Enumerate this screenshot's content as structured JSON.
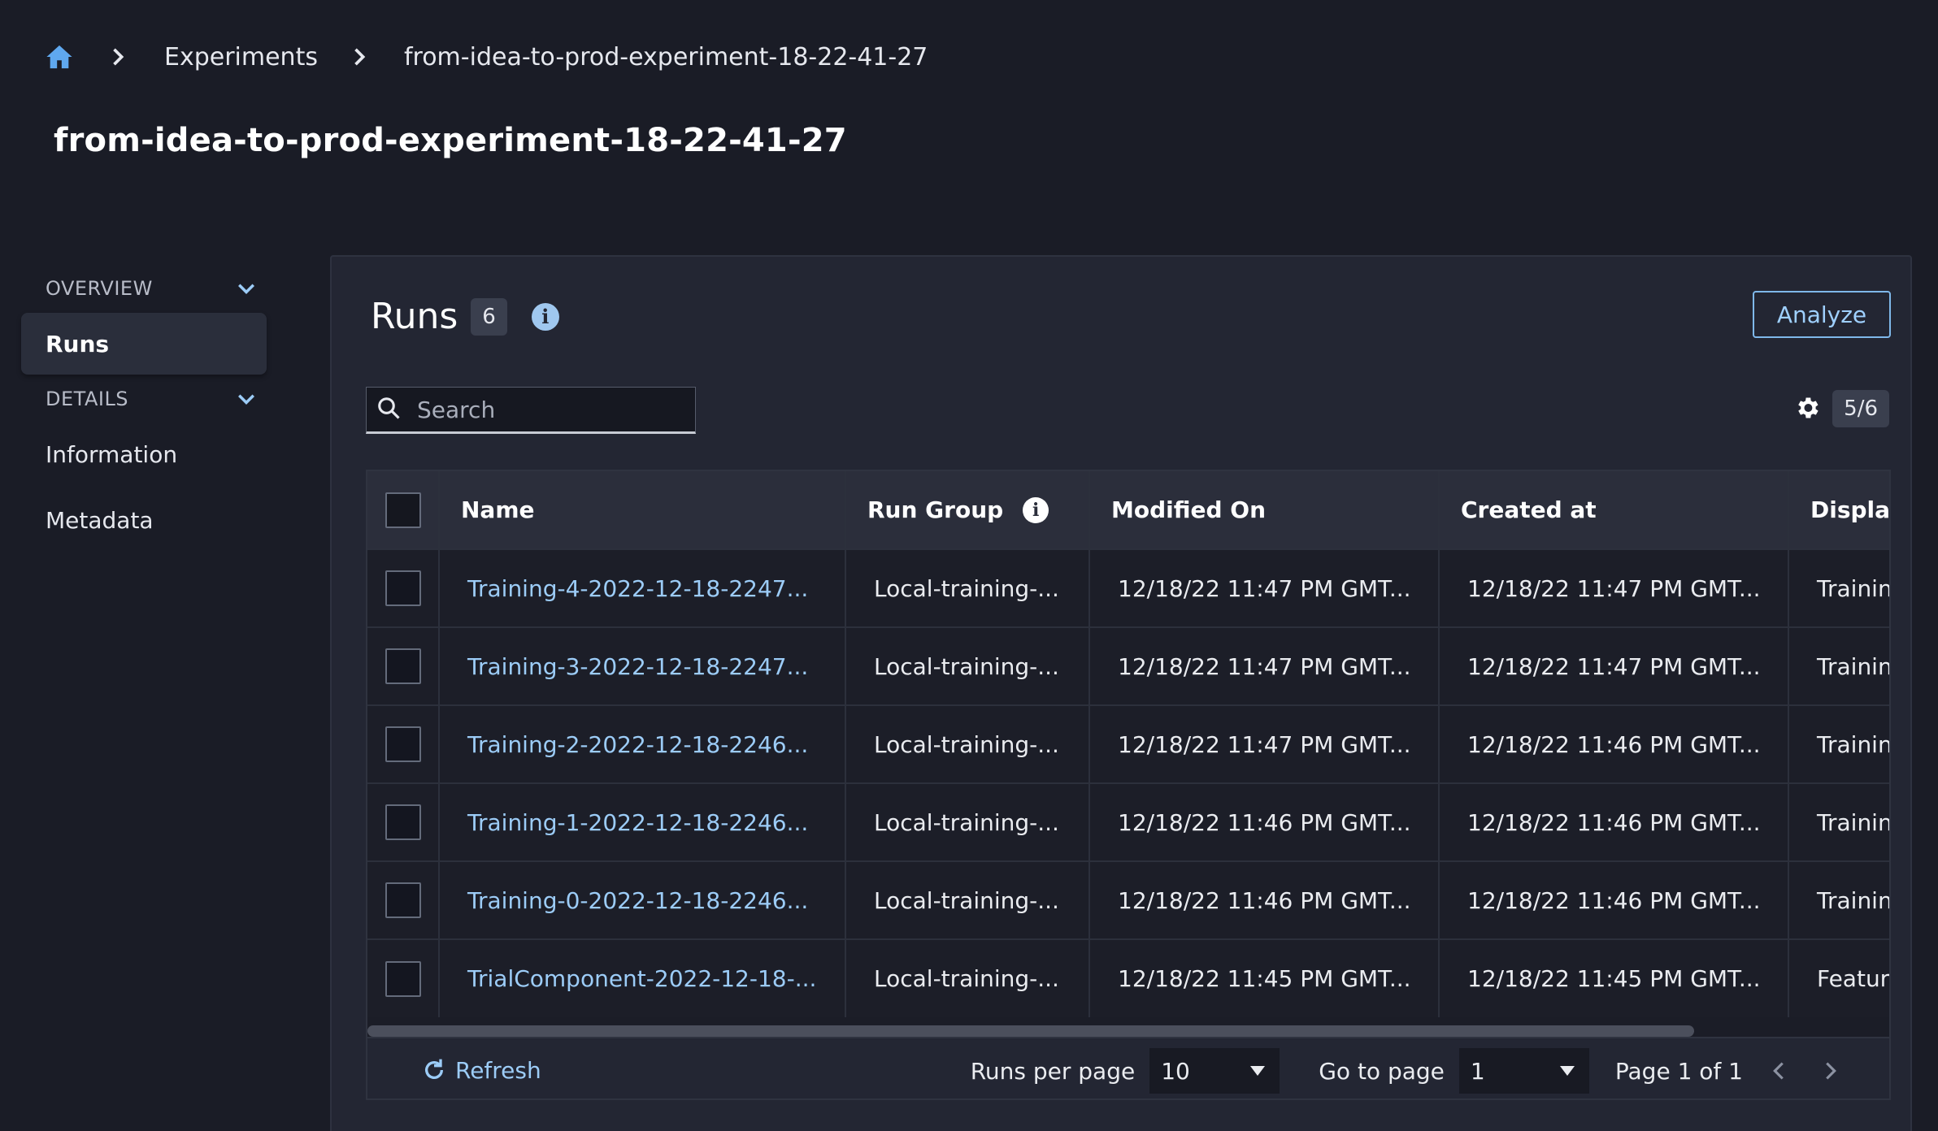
{
  "breadcrumb": {
    "items": [
      "Experiments",
      "from-idea-to-prod-experiment-18-22-41-27"
    ]
  },
  "page_title": "from-idea-to-prod-experiment-18-22-41-27",
  "sidebar": {
    "overview_label": "OVERVIEW",
    "runs_label": "Runs",
    "details_label": "DETAILS",
    "information_label": "Information",
    "metadata_label": "Metadata"
  },
  "runs": {
    "title": "Runs",
    "count": "6",
    "analyze_label": "Analyze",
    "search_placeholder": "Search",
    "visible_columns": "5/6",
    "columns": [
      "Name",
      "Run Group",
      "Modified On",
      "Created at",
      "Display"
    ],
    "rows": [
      {
        "name": "Training-4-2022-12-18-2247...",
        "run_group": "Local-training-...",
        "modified": "12/18/22 11:47 PM GMT...",
        "created": "12/18/22 11:47 PM GMT...",
        "display": "Trainin"
      },
      {
        "name": "Training-3-2022-12-18-2247...",
        "run_group": "Local-training-...",
        "modified": "12/18/22 11:47 PM GMT...",
        "created": "12/18/22 11:47 PM GMT...",
        "display": "Trainin"
      },
      {
        "name": "Training-2-2022-12-18-2246...",
        "run_group": "Local-training-...",
        "modified": "12/18/22 11:47 PM GMT...",
        "created": "12/18/22 11:46 PM GMT...",
        "display": "Trainin"
      },
      {
        "name": "Training-1-2022-12-18-2246...",
        "run_group": "Local-training-...",
        "modified": "12/18/22 11:46 PM GMT...",
        "created": "12/18/22 11:46 PM GMT...",
        "display": "Trainin"
      },
      {
        "name": "Training-0-2022-12-18-2246...",
        "run_group": "Local-training-...",
        "modified": "12/18/22 11:46 PM GMT...",
        "created": "12/18/22 11:46 PM GMT...",
        "display": "Trainin"
      },
      {
        "name": "TrialComponent-2022-12-18-...",
        "run_group": "Local-training-...",
        "modified": "12/18/22 11:45 PM GMT...",
        "created": "12/18/22 11:45 PM GMT...",
        "display": "Featur"
      }
    ],
    "footer": {
      "refresh_label": "Refresh",
      "runs_per_page_label": "Runs per page",
      "runs_per_page_value": "10",
      "go_to_page_label": "Go to page",
      "go_to_page_value": "1",
      "page_info": "Page 1 of 1"
    }
  },
  "colors": {
    "background": "#1a1c26",
    "panel": "#232633",
    "accent": "#9cccf7",
    "home_icon": "#5fa8ef"
  }
}
